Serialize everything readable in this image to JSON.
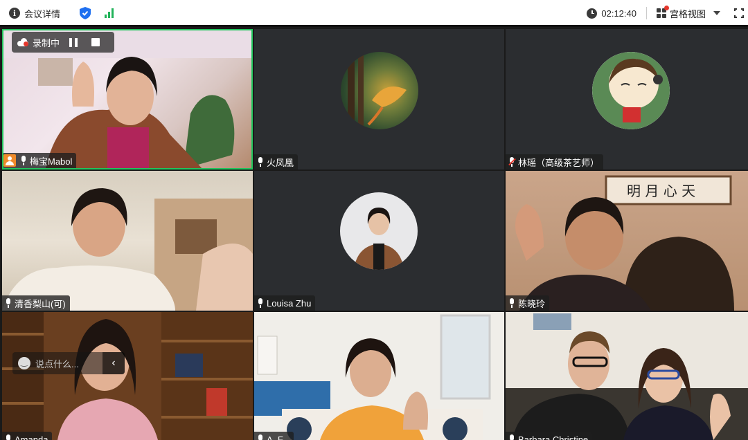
{
  "topbar": {
    "meeting_details_label": "会议详情",
    "timer": "02:12:40",
    "view_label": "宫格视图"
  },
  "recording": {
    "label": "录制中"
  },
  "chat": {
    "placeholder": "说点什么..."
  },
  "participants": [
    {
      "name": "梅宝Mabol",
      "mic": "on",
      "host": true,
      "video": true
    },
    {
      "name": "火凤凰",
      "mic": "on",
      "video": false
    },
    {
      "name": "林瑶（高级茶艺师）",
      "mic": "muted",
      "video": false
    },
    {
      "name": "清香梨山(可)",
      "mic": "on",
      "video": true
    },
    {
      "name": "Louisa Zhu",
      "mic": "on",
      "video": false
    },
    {
      "name": "陈晓玲",
      "mic": "on",
      "video": true
    },
    {
      "name": "Amanda",
      "mic": "on",
      "video": true
    },
    {
      "name": "A. F...",
      "mic": "on",
      "video": true
    },
    {
      "name": "Barbara Christine",
      "mic": "on",
      "video": true
    }
  ],
  "colors": {
    "active_speaker_border": "#21c55d",
    "tile_bg": "#2b2d30",
    "host_badge": "#f08a2a",
    "record_dot": "#e5372c",
    "signal": "#21b35a",
    "shield": "#1e6ff0"
  }
}
